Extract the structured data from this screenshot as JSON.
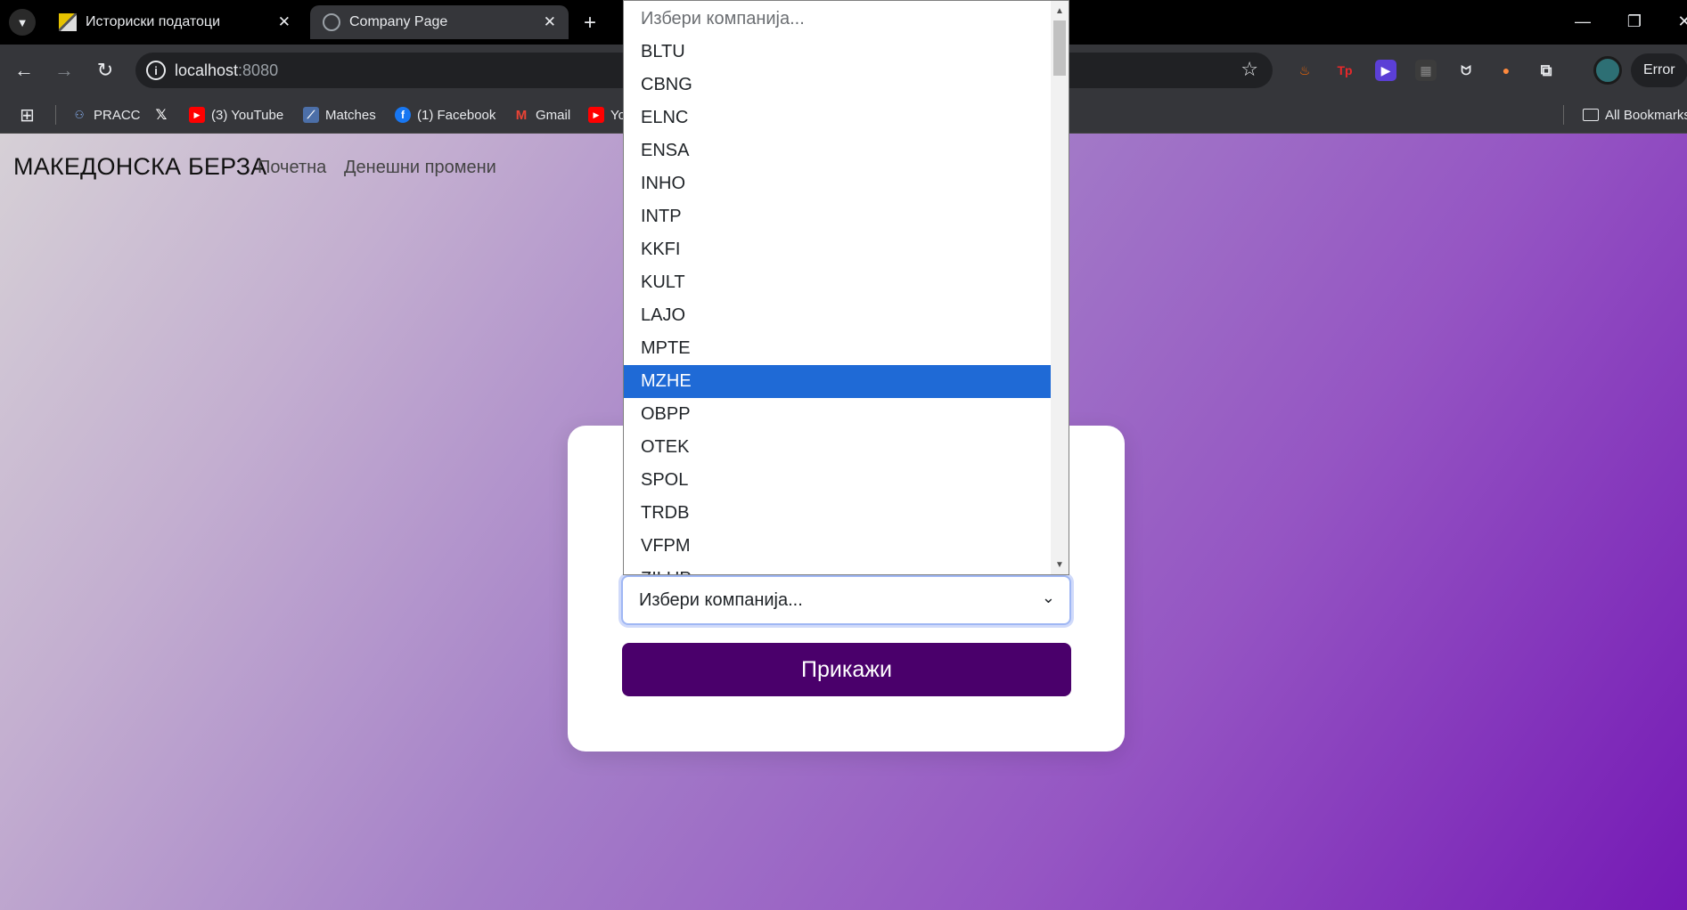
{
  "browser": {
    "tabs": [
      {
        "title": "Историски податоци"
      },
      {
        "title": "Company Page"
      }
    ],
    "url_host": "localhost",
    "url_port": ":8080",
    "profile_button": "Error",
    "bookmarks": [
      "PRACC",
      "(3) YouTube",
      "Matches",
      "(1) Facebook",
      "Gmail",
      "Yo"
    ],
    "all_bookmarks": "All Bookmarks"
  },
  "site": {
    "brand": "МАКЕДОНСКА БЕРЗА",
    "nav": [
      "Почетна",
      "Денешни промени"
    ]
  },
  "form": {
    "select_value": "Избери компанија...",
    "submit_label": "Прикажи"
  },
  "dropdown": {
    "options": [
      "Избери компанија...",
      "BLTU",
      "CBNG",
      "ELNC",
      "ENSA",
      "INHO",
      "INTP",
      "KKFI",
      "KULT",
      "LAJO",
      "MPTE",
      "MZHE",
      "OBPP",
      "OTEK",
      "SPOL",
      "TRDB",
      "VFPM",
      "ZILUP"
    ],
    "highlighted": "MZHE"
  },
  "colors": {
    "primary_button": "#4a006b",
    "highlight": "#1f6ad6",
    "gradient_start": "#d6d0d6",
    "gradient_end": "#7519b5"
  }
}
